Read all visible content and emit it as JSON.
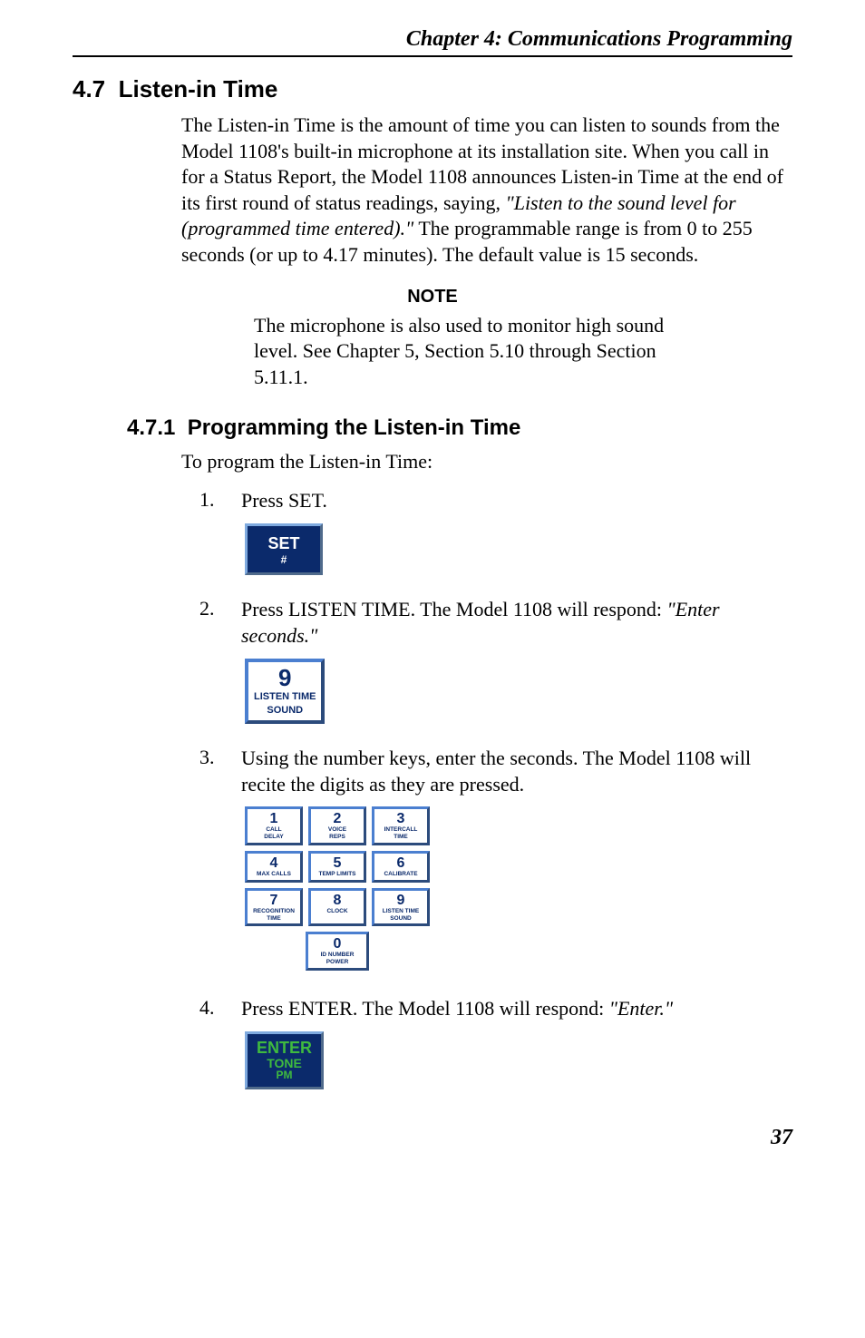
{
  "header": {
    "chapter": "Chapter  4:  Communications Programming"
  },
  "section": {
    "number": "4.7",
    "title": "Listen-in Time",
    "body": "The Listen-in Time is the amount of time you can listen to sounds from the Model 1108's built-in microphone at its installation site. When you call in for a Status Report, the Model 1108 announces Listen-in Time at the end of its first round of status readings, saying, ",
    "body_quote": "\"Listen to the sound level for (programmed time entered).\"",
    "body_after": " The programmable range is from 0 to 255 seconds (or up to 4.17 minutes). The default value is 15 seconds."
  },
  "note": {
    "heading": "NOTE",
    "body": "The microphone is also used to monitor high sound level. See Chapter 5, Section 5.10 through Section 5.11.1."
  },
  "subsection": {
    "number": "4.7.1",
    "title": "Programming the Listen-in Time",
    "lead": "To program the Listen-in Time:"
  },
  "steps": [
    {
      "text": "Press SET.",
      "key": {
        "type": "set",
        "line1": "SET",
        "line2": "#"
      }
    },
    {
      "text_pre": "Press LISTEN TIME. The Model 1108 will respond: ",
      "text_quote": "\"Enter seconds.\"",
      "key": {
        "type": "white",
        "num": "9",
        "label1": "LISTEN TIME",
        "label2": "SOUND"
      }
    },
    {
      "text": "Using the number keys, enter the seconds. The Model 1108 will recite the digits as they are pressed.",
      "key": {
        "type": "keypad"
      }
    },
    {
      "text_pre": "Press ENTER. The Model 1108 will respond: ",
      "text_quote": "\"Enter.\"",
      "key": {
        "type": "enter",
        "l1": "ENTER",
        "l2": "TONE",
        "l3": "PM"
      }
    }
  ],
  "keypad": [
    {
      "num": "1",
      "l1": "CALL",
      "l2": "DELAY"
    },
    {
      "num": "2",
      "l1": "VOICE",
      "l2": "REPS"
    },
    {
      "num": "3",
      "l1": "INTERCALL",
      "l2": "TIME"
    },
    {
      "num": "4",
      "l1": "MAX CALLS",
      "l2": ""
    },
    {
      "num": "5",
      "l1": "TEMP LIMITS",
      "l2": ""
    },
    {
      "num": "6",
      "l1": "CALIBRATE",
      "l2": ""
    },
    {
      "num": "7",
      "l1": "RECOGNITION",
      "l2": "TIME"
    },
    {
      "num": "8",
      "l1": "CLOCK",
      "l2": ""
    },
    {
      "num": "9",
      "l1": "LISTEN TIME",
      "l2": "SOUND"
    }
  ],
  "keypad_zero": {
    "num": "0",
    "l1": "ID NUMBER",
    "l2": "POWER"
  },
  "page_number": "37"
}
